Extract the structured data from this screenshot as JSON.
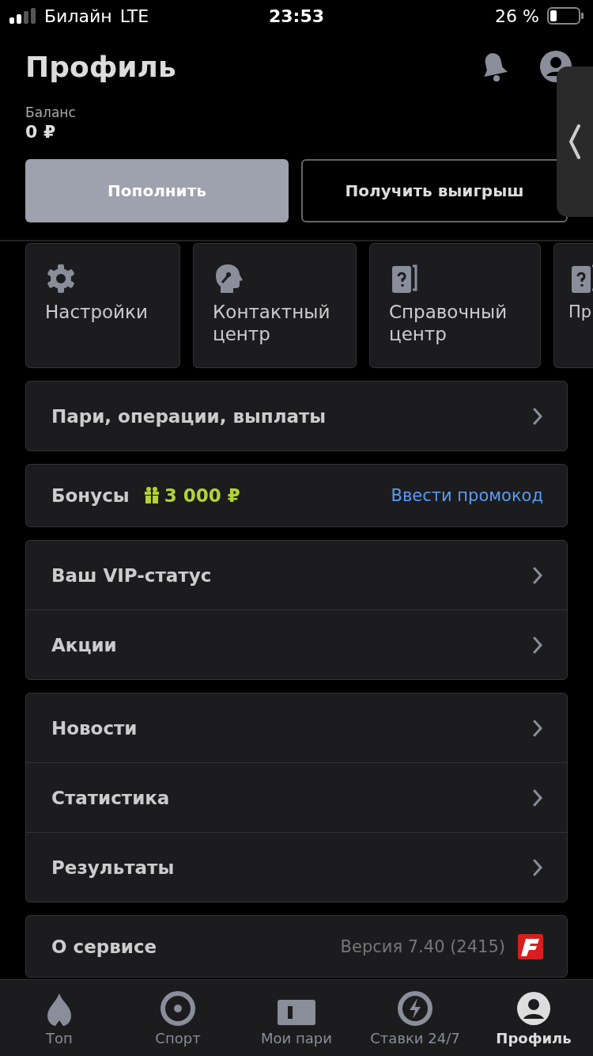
{
  "status_bar": {
    "carrier": "Билайн",
    "network": "LTE",
    "time": "23:53",
    "battery": "26 %"
  },
  "header": {
    "title": "Профиль",
    "balance_label": "Баланс",
    "balance": "0 ₽"
  },
  "buttons": [
    {
      "label": "Пополнить",
      "kind": "filled"
    },
    {
      "label": "Получить выигрыш",
      "kind": "outline"
    }
  ],
  "tiles": [
    {
      "label": "Настройки"
    },
    {
      "label": "Контактный центр"
    },
    {
      "label": "Справочный центр"
    },
    {
      "label": "Пр"
    }
  ],
  "groups": [
    [
      {
        "kind": "link",
        "label": "Пари, операции, выплаты"
      }
    ],
    [
      {
        "kind": "bonus",
        "label": "Бонусы",
        "amount": "3 000 ₽",
        "action": "Ввести промокод"
      }
    ],
    [
      {
        "kind": "link",
        "label": "Ваш VIP-статус"
      },
      {
        "kind": "link",
        "label": "Акции"
      }
    ],
    [
      {
        "kind": "link",
        "label": "Новости"
      },
      {
        "kind": "link",
        "label": "Статистика"
      },
      {
        "kind": "link",
        "label": "Результаты"
      }
    ],
    [
      {
        "kind": "about",
        "label": "О сервисе",
        "version": "Версия 7.40 (2415)"
      }
    ]
  ],
  "tab_bar": [
    {
      "label": "Топ",
      "selected": false
    },
    {
      "label": "Спорт",
      "selected": false
    },
    {
      "label": "Мои пари",
      "selected": false
    },
    {
      "label": "Ставки 24/7",
      "selected": false
    },
    {
      "label": "Профиль",
      "selected": true
    }
  ]
}
